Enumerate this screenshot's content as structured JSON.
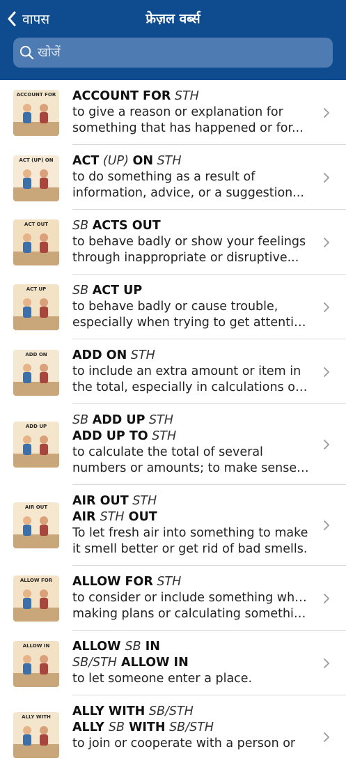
{
  "header": {
    "back_label": "वापस",
    "title": "फ्रेज़ल वर्ब्स",
    "search_placeholder": "खोजें"
  },
  "colors": {
    "header_bg": "#0f4c8f",
    "search_bg": "#4d7bb2"
  },
  "items": [
    {
      "thumb_label": "ACCOUNT FOR",
      "lines": [
        [
          {
            "t": "ACCOUNT FOR",
            "s": "b"
          },
          {
            "t": " STH",
            "s": "i"
          }
        ]
      ],
      "desc": [
        "to give a reason or explanation for",
        "something that has happened or for..."
      ]
    },
    {
      "thumb_label": "ACT (UP) ON",
      "lines": [
        [
          {
            "t": "ACT",
            "s": "b"
          },
          {
            "t": " (UP) ",
            "s": "i"
          },
          {
            "t": "ON",
            "s": "b"
          },
          {
            "t": " STH",
            "s": "i"
          }
        ]
      ],
      "desc": [
        "to do something as a result of",
        "information, advice, or a suggestion..."
      ]
    },
    {
      "thumb_label": "ACT OUT",
      "lines": [
        [
          {
            "t": "SB ",
            "s": "i"
          },
          {
            "t": "ACTS OUT",
            "s": "b"
          }
        ]
      ],
      "desc": [
        "to behave badly or show your feelings",
        "through inappropriate or disruptive..."
      ]
    },
    {
      "thumb_label": "ACT UP",
      "lines": [
        [
          {
            "t": "SB ",
            "s": "i"
          },
          {
            "t": "ACT UP",
            "s": "b"
          }
        ]
      ],
      "desc": [
        "to behave badly or cause trouble,",
        "especially when trying to get attentio..."
      ]
    },
    {
      "thumb_label": "ADD ON",
      "lines": [
        [
          {
            "t": "ADD ON",
            "s": "b"
          },
          {
            "t": " STH",
            "s": "i"
          }
        ]
      ],
      "desc": [
        "to include an extra amount or item in",
        "the total, especially in calculations or..."
      ]
    },
    {
      "thumb_label": "ADD UP",
      "lines": [
        [
          {
            "t": "SB ",
            "s": "i"
          },
          {
            "t": "ADD UP",
            "s": "b"
          },
          {
            "t": " STH",
            "s": "i"
          }
        ],
        [
          {
            "t": "ADD UP TO",
            "s": "b"
          },
          {
            "t": " STH",
            "s": "i"
          }
        ]
      ],
      "desc": [
        "to calculate the total of several",
        "numbers or amounts; to make sense ..."
      ]
    },
    {
      "thumb_label": "AIR OUT",
      "lines": [
        [
          {
            "t": "AIR OUT",
            "s": "b"
          },
          {
            "t": " STH",
            "s": "i"
          }
        ],
        [
          {
            "t": "AIR ",
            "s": "b"
          },
          {
            "t": "STH",
            "s": "i"
          },
          {
            "t": " OUT",
            "s": "b"
          }
        ]
      ],
      "desc": [
        "To let fresh air into something to make",
        "it smell better or get rid of bad smells."
      ]
    },
    {
      "thumb_label": "ALLOW FOR",
      "lines": [
        [
          {
            "t": "ALLOW FOR",
            "s": "b"
          },
          {
            "t": " STH",
            "s": "i"
          }
        ]
      ],
      "desc": [
        "to consider or include something when",
        "making plans or calculating something."
      ]
    },
    {
      "thumb_label": "ALLOW IN",
      "lines": [
        [
          {
            "t": "ALLOW ",
            "s": "b"
          },
          {
            "t": "SB",
            "s": "i"
          },
          {
            "t": " IN",
            "s": "b"
          }
        ],
        [
          {
            "t": "SB/STH",
            "s": "i"
          },
          {
            "t": " ALLOW IN",
            "s": "b"
          }
        ]
      ],
      "desc": [
        "to let someone enter a place."
      ]
    },
    {
      "thumb_label": "ALLY WITH",
      "lines": [
        [
          {
            "t": "ALLY WITH",
            "s": "b"
          },
          {
            "t": " SB/STH",
            "s": "i"
          }
        ],
        [
          {
            "t": "ALLY ",
            "s": "b"
          },
          {
            "t": "SB",
            "s": "i"
          },
          {
            "t": " WITH",
            "s": "b"
          },
          {
            "t": " SB/STH",
            "s": "i"
          }
        ]
      ],
      "desc": [
        "to join or cooperate with a person or"
      ]
    }
  ]
}
